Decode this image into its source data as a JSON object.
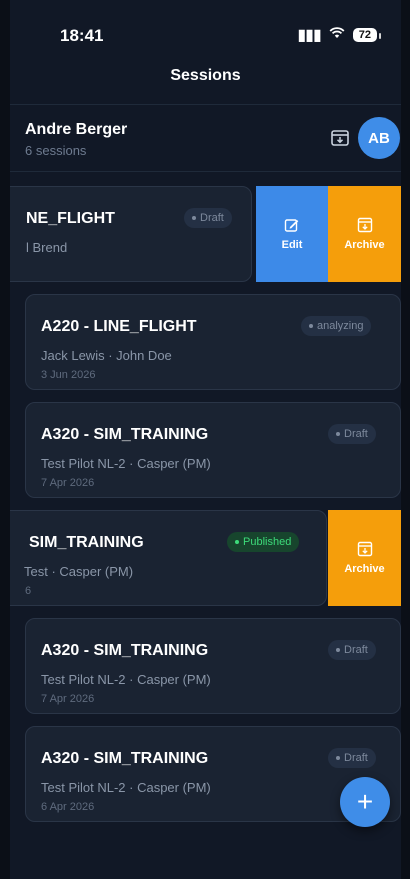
{
  "status_bar": {
    "time": "18:41",
    "battery": "72"
  },
  "nav": {
    "title": "Sessions"
  },
  "profile": {
    "name": "Andre Berger",
    "sessions_count": "6 sessions",
    "avatar_initials": "AB"
  },
  "actions": {
    "edit_label": "Edit",
    "archive_label": "Archive"
  },
  "sessions": [
    {
      "title": "NE_FLIGHT",
      "crew": "l Brend",
      "date": "",
      "status": "Draft"
    },
    {
      "title": "A220 - LINE_FLIGHT",
      "crew": "Jack Lewis · John Doe",
      "date": "3 Jun 2026",
      "status": "analyzing"
    },
    {
      "title": "A320 - SIM_TRAINING",
      "crew": "Test Pilot NL-2 · Casper (PM)",
      "date": "7 Apr 2026",
      "status": "Draft"
    },
    {
      "title": "SIM_TRAINING",
      "crew": "Test · Casper (PM)",
      "date": "6",
      "status": "Published"
    },
    {
      "title": "A320 - SIM_TRAINING",
      "crew": "Test Pilot NL-2 · Casper (PM)",
      "date": "7 Apr 2026",
      "status": "Draft"
    },
    {
      "title": "A320 - SIM_TRAINING",
      "crew": "Test Pilot NL-2 · Casper (PM)",
      "date": "6 Apr 2026",
      "status": "Draft"
    }
  ],
  "colors": {
    "accent": "#3f8de8",
    "archive": "#f59e0b",
    "published": "#3ddb7a",
    "background": "#111826",
    "card": "#1a2332"
  },
  "icons": {
    "archive": "archive-box-icon",
    "edit": "edit-icon",
    "add": "plus-icon"
  }
}
